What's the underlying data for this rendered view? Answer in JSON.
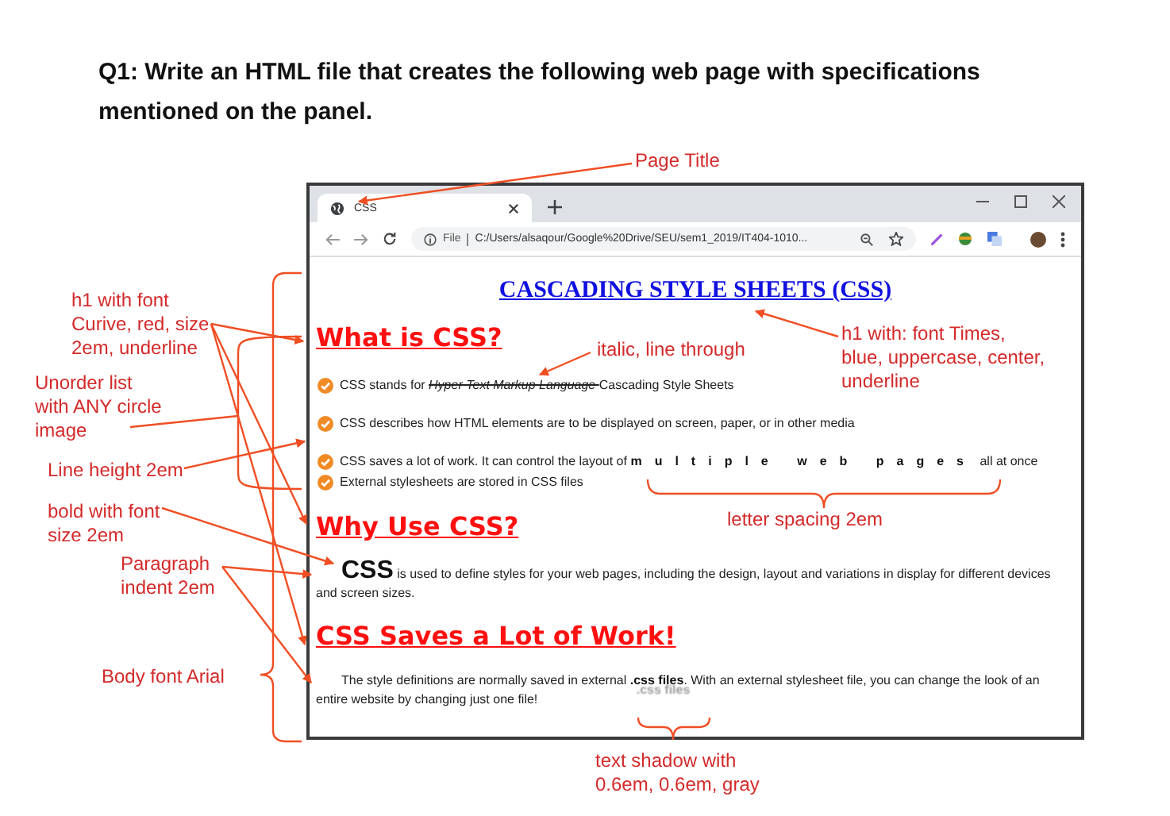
{
  "question": {
    "text": "Q1: Write an HTML file that creates the following web page with specifications mentioned on the panel."
  },
  "browser": {
    "tab": {
      "title": "CSS",
      "selected": true
    },
    "address": {
      "scheme": "File",
      "url": "C:/Users/alsaqour/Google%20Drive/SEU/sem1_2019/IT404-1010..."
    },
    "page": {
      "title": "CASCADING STYLE SHEETS (CSS)",
      "sections": [
        {
          "heading": "What is CSS?",
          "kind": "list",
          "items": [
            [
              {
                "kind": "plain",
                "text": "CSS stands for "
              },
              {
                "kind": "struck",
                "text": "Hyper Text Markup Language "
              },
              {
                "kind": "plain",
                "text": "Cascading Style Sheets"
              }
            ],
            [
              {
                "kind": "plain",
                "text": "CSS describes how HTML elements are to be displayed on screen, paper, or in other media"
              }
            ],
            [
              {
                "kind": "plain",
                "text": "CSS saves a lot of work. It can control the layout of "
              },
              {
                "kind": "spaced",
                "text": "multiple web pages"
              },
              {
                "kind": "plain",
                "text": " all at once"
              }
            ],
            [
              {
                "kind": "plain",
                "text": "External stylesheets are stored in CSS files"
              }
            ]
          ]
        },
        {
          "heading": "Why Use CSS?",
          "kind": "paragraph",
          "segments": [
            {
              "kind": "lead",
              "text": "CSS"
            },
            {
              "kind": "plain",
              "text": " is used to define styles for your web pages, including the design, layout and variations in display for different devices and screen sizes."
            }
          ]
        },
        {
          "heading": "CSS Saves a Lot of Work!",
          "kind": "paragraph",
          "segments": [
            {
              "kind": "plain",
              "text": "The style definitions are normally saved in external "
            },
            {
              "kind": "shadow",
              "text": ".css files"
            },
            {
              "kind": "plain",
              "text": ". With an external stylesheet file, you can change the look of an entire website by changing just one file!"
            }
          ]
        }
      ]
    }
  },
  "annotations": [
    {
      "lines": [
        "Page Title"
      ]
    },
    {
      "lines": [
        "h1 with font",
        "Curive, red, size",
        "2em, underline"
      ]
    },
    {
      "lines": [
        "Unorder list",
        "with ANY circle",
        "image"
      ]
    },
    {
      "lines": [
        "Line height 2em"
      ]
    },
    {
      "lines": [
        "bold with font",
        "size 2em"
      ]
    },
    {
      "lines": [
        "Paragraph",
        "indent 2em"
      ]
    },
    {
      "lines": [
        "Body font Arial"
      ]
    },
    {
      "lines": [
        "italic, line through"
      ]
    },
    {
      "lines": [
        "h1 with: font Times,",
        "blue, uppercase, center,",
        "underline"
      ]
    },
    {
      "lines": [
        "letter spacing 2em"
      ]
    },
    {
      "lines": [
        "text shadow with",
        "0.6em, 0.6em, gray"
      ]
    }
  ]
}
